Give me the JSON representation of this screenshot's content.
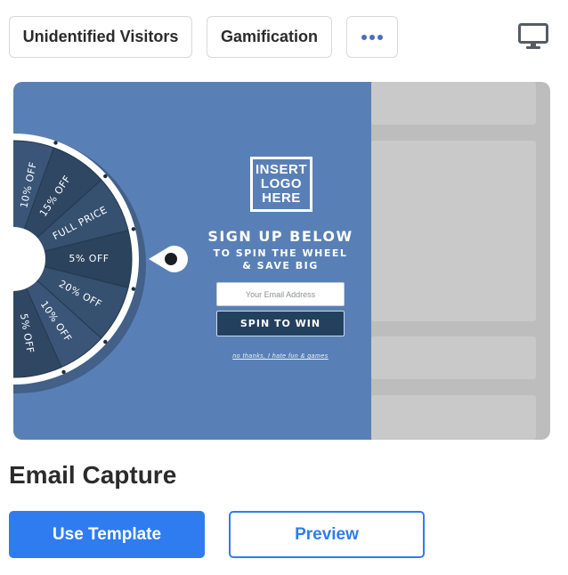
{
  "filters": {
    "audience_tag": "Unidentified Visitors",
    "type_tag": "Gamification",
    "more_icon": "more-horizontal-icon"
  },
  "device": {
    "icon": "desktop-monitor-icon"
  },
  "popup": {
    "logo_lines": [
      "INSERT",
      "LOGO",
      "HERE"
    ],
    "headline": "SIGN UP BELOW",
    "subheadline_lines": [
      "TO SPIN THE WHEEL",
      "& SAVE BIG"
    ],
    "email_placeholder": "Your Email Address",
    "cta": "SPIN TO WIN",
    "decline": "no thanks, I hate fun & games",
    "wheel_segments": [
      "10% OFF",
      "15% OFF",
      "FULL PRICE",
      "5% OFF",
      "20% OFF",
      "10% OFF",
      "5% OFF"
    ],
    "colors": {
      "background": "#5980b6",
      "wheel_dark": "#2f4763",
      "cta": "#24405f"
    }
  },
  "template": {
    "title": "Email Capture",
    "use_label": "Use Template",
    "preview_label": "Preview",
    "accent": "#2f7cf0"
  }
}
